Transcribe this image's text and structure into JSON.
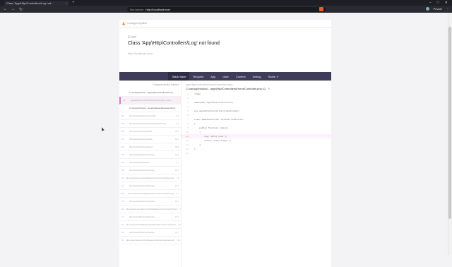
{
  "browser": {
    "tab_title": "Class 'App\\Http\\Controllers\\Log' not...",
    "tab_close": "×",
    "new_tab": "+",
    "not_secure": "Not secure",
    "url": "http://localhost:xxxx",
    "profile_label": "Private"
  },
  "error": {
    "breadcrumb": "Contagion/Ignition",
    "type": "Error",
    "message": "Class 'App\\Http\\Controllers\\Log' not found",
    "url": "http://localhost:xxxx"
  },
  "tabs": [
    "Stack trace",
    "Request",
    "App",
    "User",
    "Context",
    "Debug",
    "Share"
  ],
  "frames_header": {
    "left": "",
    "right": "Collapse vendor frames"
  },
  "frames": [
    {
      "num": "",
      "text": "C:\\xampp\\htdocs\\...\\app\\Http\\Controllers\\Home",
      "line": "",
      "cls": "app"
    },
    {
      "num": "31",
      "text": "App\\Http\\Controllers\\HomeController::index",
      "line": "",
      "cls": "active"
    },
    {
      "num": "",
      "text": "C:\\xampp\\htdocs\\...\\vendor\\laravel\\framework\\src",
      "line": "",
      "cls": "app"
    },
    {
      "num": "30",
      "text": "Illuminate\\Routing\\Controller",
      "line": "54",
      "cls": ""
    },
    {
      "num": "29",
      "text": "Illuminate\\Routing\\ControllerDispatcher",
      "line": "45",
      "cls": ""
    },
    {
      "num": "28",
      "text": "Illuminate\\Routing\\Route",
      "line": "239",
      "cls": ""
    },
    {
      "num": "27",
      "text": "Illuminate\\Routing\\Route",
      "line": "196",
      "cls": ""
    },
    {
      "num": "26",
      "text": "Illuminate\\Routing\\Router",
      "line": "685",
      "cls": ""
    },
    {
      "num": "25",
      "text": "Illuminate\\Pipeline\\Pipeline",
      "line": "128",
      "cls": ""
    },
    {
      "num": "24",
      "text": "Illuminate\\Middleware",
      "line": "41",
      "cls": ""
    },
    {
      "num": "23",
      "text": "Illuminate\\Pipeline\\Pipeline",
      "line": "167",
      "cls": ""
    },
    {
      "num": "22",
      "text": "Illuminate\\Session\\Middleware\\AuthenticateSession",
      "line": "49",
      "cls": ""
    },
    {
      "num": "21",
      "text": "Illuminate\\Pipeline\\Pipeline",
      "line": "167",
      "cls": ""
    },
    {
      "num": "20",
      "text": "Illuminate\\Routing\\Middleware\\SubstituteBindings",
      "line": "41",
      "cls": ""
    },
    {
      "num": "19",
      "text": "Illuminate\\Pipeline\\Pipeline",
      "line": "167",
      "cls": ""
    },
    {
      "num": "18",
      "text": "Illuminate\\Foundation\\Http\\Middleware\\VerifyCsrfToken",
      "line": "78",
      "cls": ""
    },
    {
      "num": "17",
      "text": "Illuminate\\Pipeline\\Pipeline",
      "line": "167",
      "cls": ""
    },
    {
      "num": "16",
      "text": "Illuminate\\View\\Middleware\\ShareErrorsFromSession",
      "line": "49",
      "cls": ""
    },
    {
      "num": "15",
      "text": "Illuminate\\Pipeline\\Pipeline",
      "line": "167",
      "cls": ""
    },
    {
      "num": "14",
      "text": "Illuminate\\Session\\Middleware\\AuthenticateSession",
      "line": "121",
      "cls": ""
    }
  ],
  "code": {
    "namespace": "App\\Http\\Controllers\\HomeController:index",
    "path": "C:\\xampp\\htdocs\\...\\app\\Http\\Controllers\\HomeController.php:11",
    "lines": [
      {
        "n": "1",
        "t": "<?php",
        "hl": false
      },
      {
        "n": "2",
        "t": "",
        "hl": false
      },
      {
        "n": "3",
        "t": "namespace App\\Http\\Controllers;",
        "hl": false
      },
      {
        "n": "4",
        "t": "",
        "hl": false
      },
      {
        "n": "5",
        "t": "use App\\Http\\Controllers\\Controller;",
        "hl": false
      },
      {
        "n": "6",
        "t": "",
        "hl": false
      },
      {
        "n": "7",
        "t": "class HomeController extends Controller",
        "hl": false
      },
      {
        "n": "8",
        "t": "{",
        "hl": false
      },
      {
        "n": "9",
        "t": "    public function index()",
        "hl": false
      },
      {
        "n": "10",
        "t": "    {",
        "hl": false
      },
      {
        "n": "11",
        "t": "        Log::info('test');",
        "hl": true
      },
      {
        "n": "12",
        "t": "        return view('index');",
        "hl": false
      },
      {
        "n": "13",
        "t": "    }",
        "hl": false
      },
      {
        "n": "14",
        "t": "}",
        "hl": false
      },
      {
        "n": "15",
        "t": "",
        "hl": false
      }
    ]
  }
}
